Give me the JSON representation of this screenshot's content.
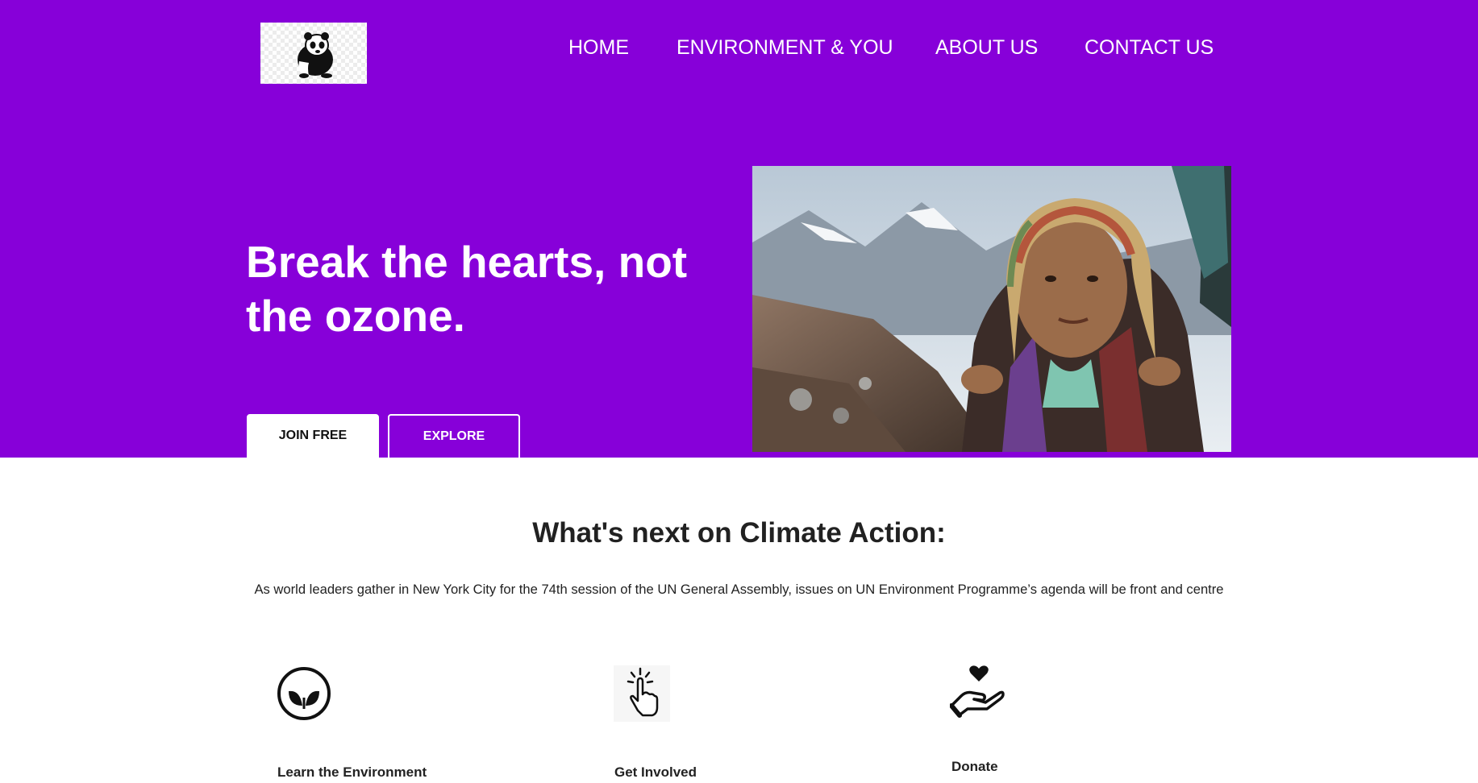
{
  "brand": {
    "logo_icon": "panda-logo-icon"
  },
  "nav": {
    "items": [
      {
        "label": "HOME"
      },
      {
        "label": "ENVIRONMENT & YOU"
      },
      {
        "label": "ABOUT US"
      },
      {
        "label": "CONTACT US"
      }
    ]
  },
  "hero": {
    "headline": "Break the hearts, not the ozone.",
    "join_label": "JOIN FREE",
    "explore_label": "EXPLORE",
    "image_subject": "woman in headscarf with mountain backdrop"
  },
  "climate": {
    "title": "What's next on Climate Action:",
    "description": "As world leaders gather in New York City for the 74th session of the UN General Assembly, issues on UN Environment Programme’s agenda will be front and centre"
  },
  "features": [
    {
      "label": "Learn the Environment",
      "icon": "leaf-circle-icon"
    },
    {
      "label": "Get Involved",
      "icon": "pointer-hand-icon"
    },
    {
      "label": "Donate",
      "icon": "heart-hand-icon"
    }
  ],
  "colors": {
    "brand_purple": "#8700d9",
    "white": "#ffffff",
    "heading_dark": "#212121"
  }
}
